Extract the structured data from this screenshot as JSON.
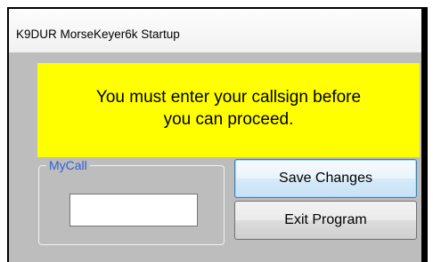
{
  "window": {
    "title": "K9DUR MorseKeyer6k Startup"
  },
  "message": {
    "line1": "You must enter your callsign before",
    "line2": "you can proceed."
  },
  "mycall_group": {
    "legend": "MyCall",
    "input_value": ""
  },
  "buttons": {
    "save_label": "Save Changes",
    "exit_label": "Exit Program"
  },
  "colors": {
    "message_background": "#ffff00",
    "window_background": "#bdbdbd",
    "legend_text": "#2e63d6"
  }
}
